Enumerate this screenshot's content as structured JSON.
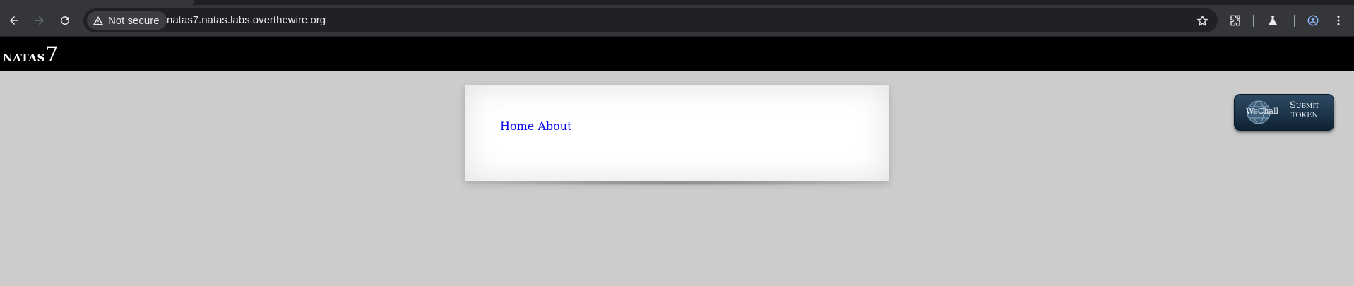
{
  "browser": {
    "security_chip": "Not secure",
    "url": "natas7.natas.labs.overthewire.org",
    "icons": [
      "back-icon",
      "forward-icon",
      "reload-icon",
      "warning-icon",
      "star-icon",
      "extensions-icon",
      "labs-flask-icon",
      "profile-icon",
      "menu-dots-icon"
    ]
  },
  "page": {
    "title_prefix": "natas",
    "title_number": "7",
    "nav": {
      "home": "Home",
      "about": "About"
    },
    "wechall": {
      "logo": "WeChall",
      "submit_line1": "Submit",
      "submit_line2": "token"
    }
  },
  "colors": {
    "page_bg": "#cccccc",
    "header_bg": "#000000",
    "link": "#0000ee",
    "chrome_toolbar": "#35363a",
    "omnibox": "#202124"
  }
}
